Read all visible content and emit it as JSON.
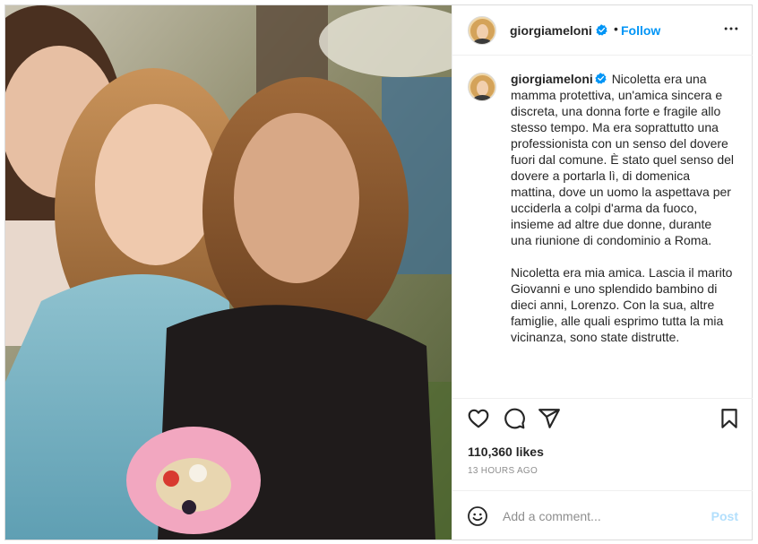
{
  "post": {
    "username": "giorgiameloni",
    "follow_label": "Follow",
    "separator": "•",
    "caption_p1": "Nicoletta era una mamma protettiva, un'amica sincera e discreta, una donna forte e fragile allo stesso tempo. Ma era soprattutto una professionista con un senso del dovere fuori dal comune. È stato quel senso del dovere a portarla lì, di domenica mattina, dove un uomo la aspettava per ucciderla a colpi d'arma da fuoco, insieme ad altre due donne, durante una riunione di condominio a Roma.",
    "caption_p2": "Nicoletta era mia amica. Lascia il marito Giovanni e uno splendido bambino di dieci anni, Lorenzo. Con la sua, altre famiglie, alle quali esprimo tutta la mia vicinanza, sono state distrutte.",
    "likes": "110,360 likes",
    "timestamp": "13 HOURS AGO"
  },
  "comment": {
    "placeholder": "Add a comment...",
    "post_label": "Post"
  },
  "icons": {
    "more": "more-options-icon",
    "like": "heart-icon",
    "comment": "comment-icon",
    "share": "share-icon",
    "save": "bookmark-icon",
    "emoji": "emoji-icon",
    "verified": "verified-badge-icon"
  },
  "colors": {
    "accent": "#0095f6",
    "post_disabled": "#b2dffc",
    "muted": "#8e8e8e",
    "border": "#dbdbdb"
  }
}
